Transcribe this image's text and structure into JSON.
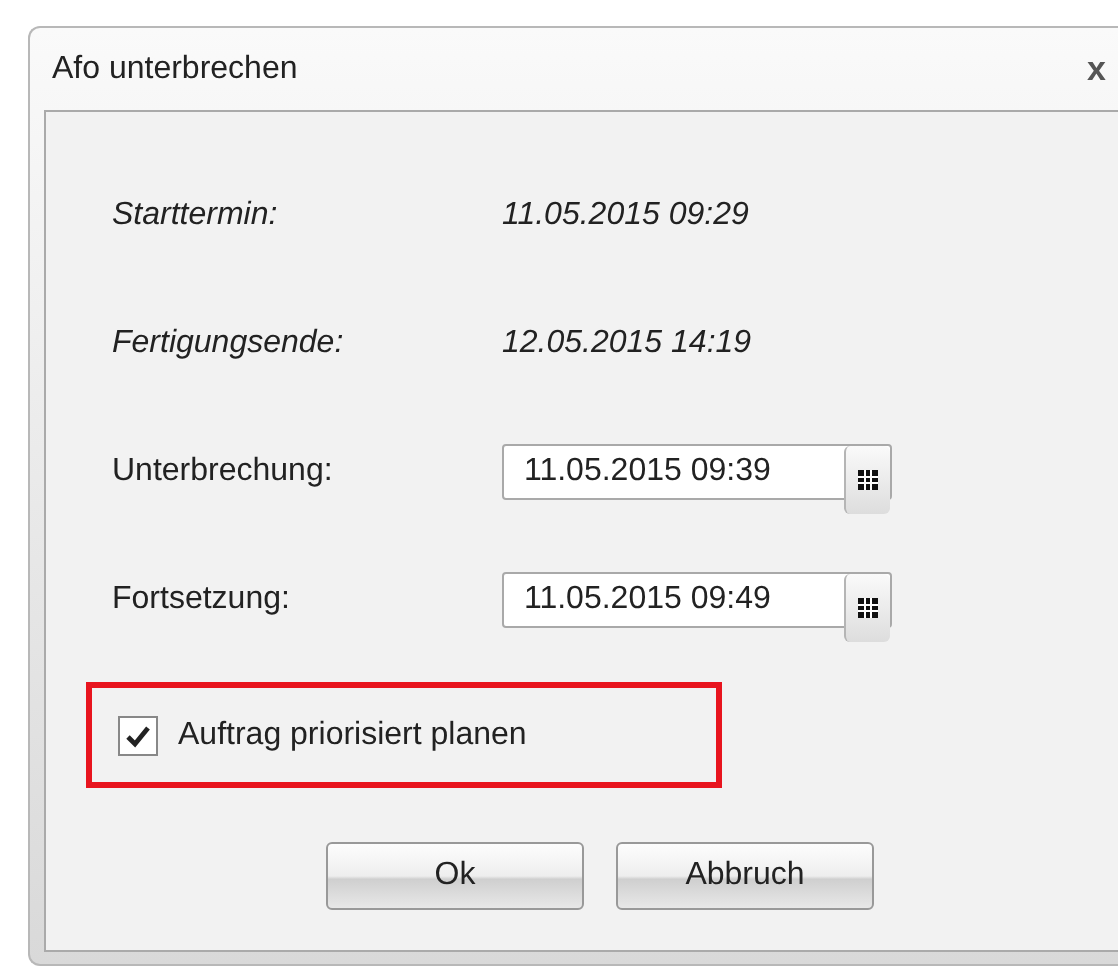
{
  "window": {
    "title": "Afo unterbrechen",
    "close": "x"
  },
  "info_rows": [
    {
      "label": "Starttermin:",
      "value": "11.05.2015 09:29"
    },
    {
      "label": "Fertigungsende:",
      "value": "12.05.2015 14:19"
    }
  ],
  "date_fields": [
    {
      "label": "Unterbrechung:",
      "value": "11.05.2015 09:39"
    },
    {
      "label": "Fortsetzung:",
      "value": "11.05.2015 09:49"
    }
  ],
  "checkbox": {
    "label": "Auftrag priorisiert planen",
    "checked": true,
    "highlighted": true
  },
  "buttons": [
    "Ok",
    "Abbruch"
  ]
}
